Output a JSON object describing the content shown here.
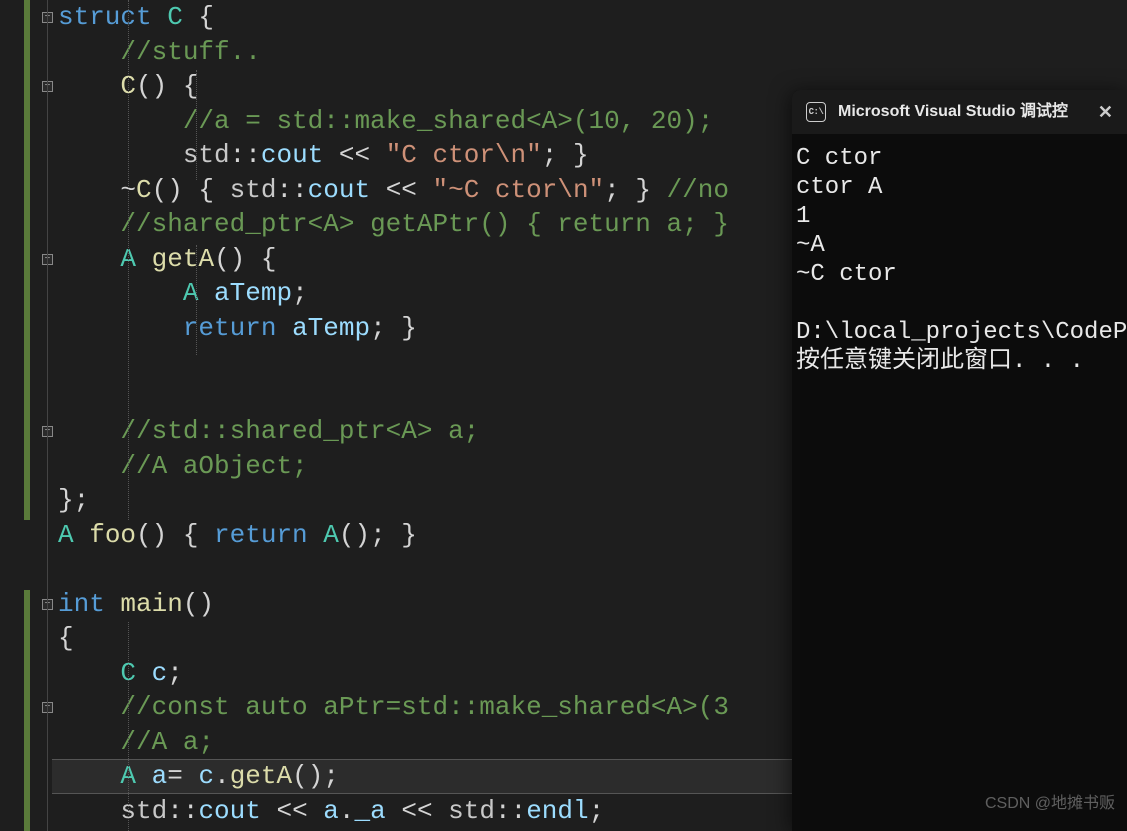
{
  "code": {
    "lines": [
      {
        "segs": [
          {
            "t": "struct ",
            "c": "kw"
          },
          {
            "t": "C",
            "c": "type"
          },
          {
            "t": " {",
            "c": "punc"
          }
        ]
      },
      {
        "segs": [
          {
            "t": "    ",
            "c": ""
          },
          {
            "t": "//stuff..",
            "c": "com"
          }
        ]
      },
      {
        "segs": [
          {
            "t": "    ",
            "c": ""
          },
          {
            "t": "C",
            "c": "fn"
          },
          {
            "t": "() {",
            "c": "punc"
          }
        ]
      },
      {
        "segs": [
          {
            "t": "        ",
            "c": ""
          },
          {
            "t": "//a = std::make_shared<A>(10, 20);",
            "c": "com"
          }
        ]
      },
      {
        "segs": [
          {
            "t": "        ",
            "c": ""
          },
          {
            "t": "std",
            "c": "ns"
          },
          {
            "t": "::",
            "c": "op"
          },
          {
            "t": "cout",
            "c": "var"
          },
          {
            "t": " << ",
            "c": "op"
          },
          {
            "t": "\"C ctor\\n\"",
            "c": "str"
          },
          {
            "t": "; }",
            "c": "punc"
          }
        ]
      },
      {
        "segs": [
          {
            "t": "    ~",
            "c": "punc"
          },
          {
            "t": "C",
            "c": "fn"
          },
          {
            "t": "() { ",
            "c": "punc"
          },
          {
            "t": "std",
            "c": "ns"
          },
          {
            "t": "::",
            "c": "op"
          },
          {
            "t": "cout",
            "c": "var"
          },
          {
            "t": " << ",
            "c": "op"
          },
          {
            "t": "\"~C ctor\\n\"",
            "c": "str"
          },
          {
            "t": "; } ",
            "c": "punc"
          },
          {
            "t": "//no",
            "c": "com"
          }
        ]
      },
      {
        "segs": [
          {
            "t": "    ",
            "c": ""
          },
          {
            "t": "//shared_ptr<A> getAPtr() { return a; }",
            "c": "com"
          }
        ]
      },
      {
        "segs": [
          {
            "t": "    ",
            "c": ""
          },
          {
            "t": "A",
            "c": "type"
          },
          {
            "t": " ",
            "c": ""
          },
          {
            "t": "getA",
            "c": "fn"
          },
          {
            "t": "() {",
            "c": "punc"
          }
        ]
      },
      {
        "segs": [
          {
            "t": "        ",
            "c": ""
          },
          {
            "t": "A",
            "c": "type"
          },
          {
            "t": " ",
            "c": ""
          },
          {
            "t": "aTemp",
            "c": "var"
          },
          {
            "t": ";",
            "c": "punc"
          }
        ]
      },
      {
        "segs": [
          {
            "t": "        ",
            "c": ""
          },
          {
            "t": "return",
            "c": "kw"
          },
          {
            "t": " ",
            "c": ""
          },
          {
            "t": "aTemp",
            "c": "var"
          },
          {
            "t": "; }",
            "c": "punc"
          }
        ]
      },
      {
        "segs": [
          {
            "t": " ",
            "c": ""
          }
        ]
      },
      {
        "segs": [
          {
            "t": " ",
            "c": ""
          }
        ]
      },
      {
        "segs": [
          {
            "t": "    ",
            "c": ""
          },
          {
            "t": "//std::shared_ptr<A> a;",
            "c": "com"
          }
        ]
      },
      {
        "segs": [
          {
            "t": "    ",
            "c": ""
          },
          {
            "t": "//A aObject;",
            "c": "com"
          }
        ]
      },
      {
        "segs": [
          {
            "t": "};",
            "c": "punc"
          }
        ]
      },
      {
        "segs": [
          {
            "t": "A",
            "c": "type"
          },
          {
            "t": " ",
            "c": ""
          },
          {
            "t": "foo",
            "c": "fn"
          },
          {
            "t": "() { ",
            "c": "punc"
          },
          {
            "t": "return",
            "c": "kw"
          },
          {
            "t": " ",
            "c": ""
          },
          {
            "t": "A",
            "c": "type"
          },
          {
            "t": "(); }",
            "c": "punc"
          }
        ]
      },
      {
        "segs": [
          {
            "t": " ",
            "c": ""
          }
        ]
      },
      {
        "segs": [
          {
            "t": "int",
            "c": "kw"
          },
          {
            "t": " ",
            "c": ""
          },
          {
            "t": "main",
            "c": "fn"
          },
          {
            "t": "()",
            "c": "punc"
          }
        ]
      },
      {
        "segs": [
          {
            "t": "{",
            "c": "punc"
          }
        ]
      },
      {
        "segs": [
          {
            "t": "    ",
            "c": ""
          },
          {
            "t": "C",
            "c": "type"
          },
          {
            "t": " ",
            "c": ""
          },
          {
            "t": "c",
            "c": "var"
          },
          {
            "t": ";",
            "c": "punc"
          }
        ]
      },
      {
        "segs": [
          {
            "t": "    ",
            "c": ""
          },
          {
            "t": "//const auto aPtr=std::make_shared<A>(3",
            "c": "com"
          }
        ]
      },
      {
        "segs": [
          {
            "t": "    ",
            "c": ""
          },
          {
            "t": "//A a;",
            "c": "com"
          }
        ]
      },
      {
        "segs": [
          {
            "t": "    ",
            "c": ""
          },
          {
            "t": "A",
            "c": "type"
          },
          {
            "t": " ",
            "c": ""
          },
          {
            "t": "a",
            "c": "var"
          },
          {
            "t": "= ",
            "c": "op"
          },
          {
            "t": "c",
            "c": "var"
          },
          {
            "t": ".",
            "c": "op"
          },
          {
            "t": "getA",
            "c": "fn"
          },
          {
            "t": "();",
            "c": "punc"
          }
        ]
      },
      {
        "segs": [
          {
            "t": "    ",
            "c": ""
          },
          {
            "t": "std",
            "c": "ns"
          },
          {
            "t": "::",
            "c": "op"
          },
          {
            "t": "cout",
            "c": "var"
          },
          {
            "t": " << ",
            "c": "op"
          },
          {
            "t": "a",
            "c": "var"
          },
          {
            "t": ".",
            "c": "op"
          },
          {
            "t": "_a",
            "c": "var"
          },
          {
            "t": " << ",
            "c": "op"
          },
          {
            "t": "std",
            "c": "ns"
          },
          {
            "t": "::",
            "c": "op"
          },
          {
            "t": "endl",
            "c": "var"
          },
          {
            "t": ";",
            "c": "punc"
          }
        ]
      }
    ]
  },
  "folds": {
    "boxes": [
      0,
      2,
      7,
      12,
      17,
      20
    ],
    "minus": "−"
  },
  "console": {
    "title": "Microsoft Visual Studio 调试控",
    "icon_text": "C:\\",
    "output": "C ctor\nctor A\n1\n~A\n~C ctor\n\nD:\\local_projects\\CodePl\n按任意键关闭此窗口. . ."
  },
  "highlight_line_index": 22,
  "watermark": "CSDN @地摊书贩"
}
